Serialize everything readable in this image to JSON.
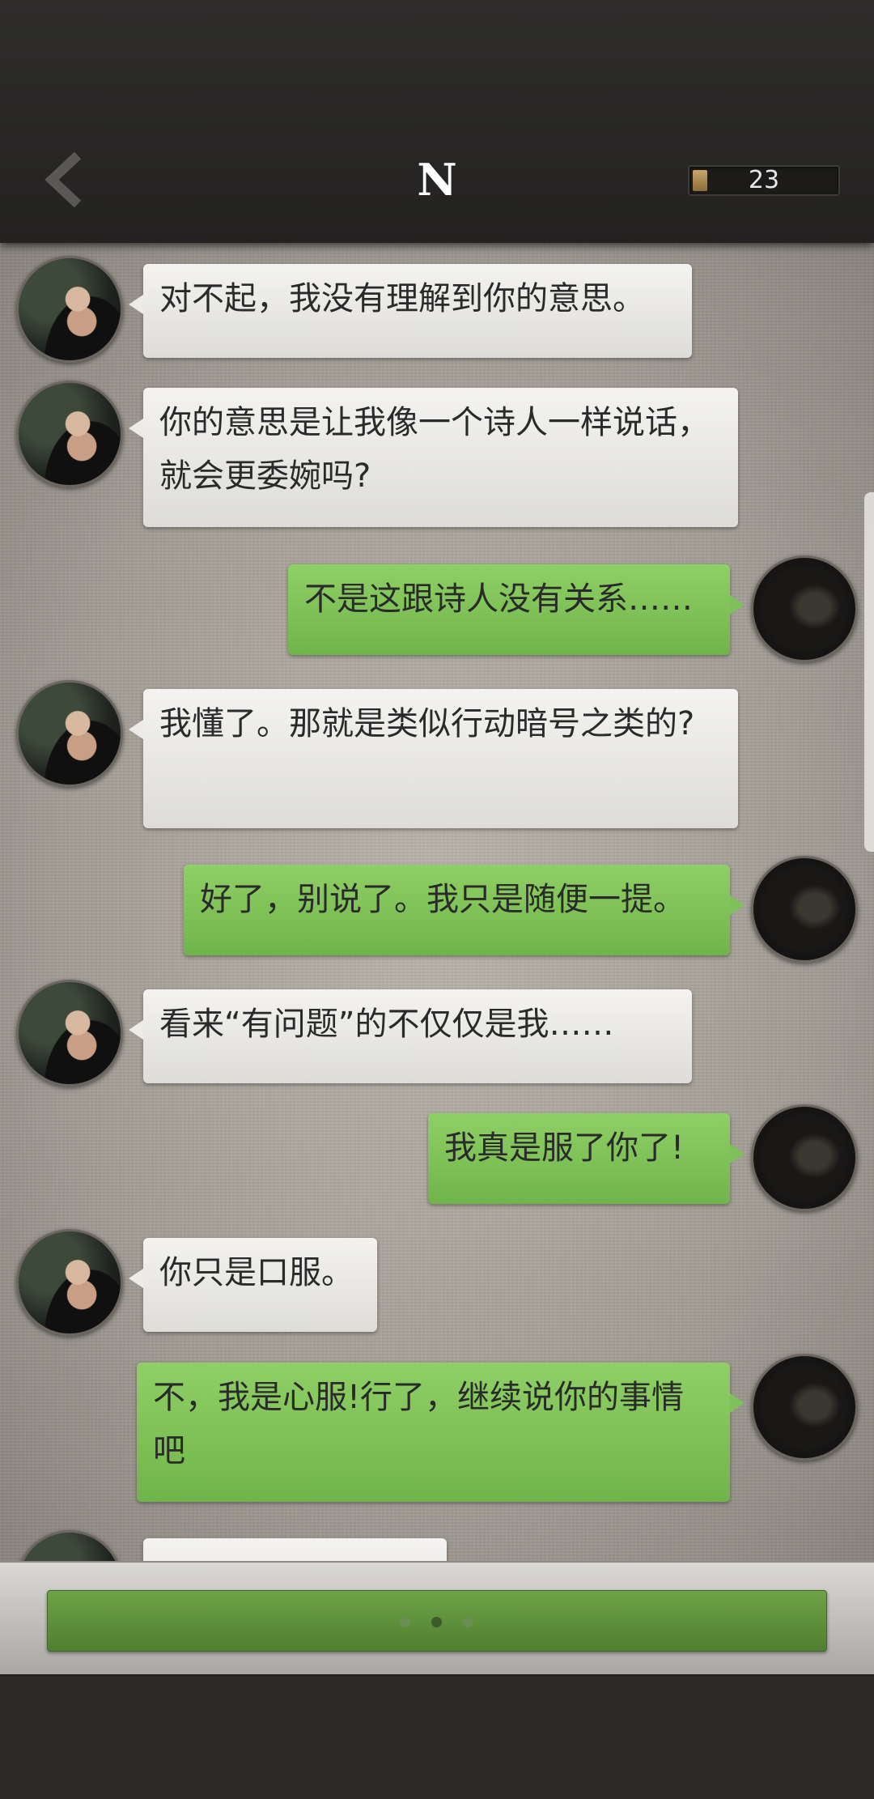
{
  "header": {
    "title": "N",
    "counter": "23",
    "back_icon": "chevron-left-icon"
  },
  "messages": [
    {
      "from": "other",
      "text": "对不起，我没有理解到你的意思。"
    },
    {
      "from": "other",
      "text": "你的意思是让我像一个诗人一样说话，就会更委婉吗?"
    },
    {
      "from": "me",
      "text": "不是这跟诗人没有关系……"
    },
    {
      "from": "other",
      "text": "我懂了。那就是类似行动暗号之类的?"
    },
    {
      "from": "me",
      "text": "好了，别说了。我只是随便一提。"
    },
    {
      "from": "other",
      "text": "看来“有问题”的不仅仅是我……"
    },
    {
      "from": "me",
      "text": "我真是服了你了!"
    },
    {
      "from": "other",
      "text": "你只是口服。"
    },
    {
      "from": "me",
      "text": "不，我是心服!行了，继续说你的事情吧"
    },
    {
      "from": "other",
      "text": ""
    }
  ],
  "input": {
    "typing_indicator": "three-dots"
  },
  "colors": {
    "me_bubble": "#7ec05a",
    "other_bubble": "#ecebe8",
    "input_button": "#5e9140"
  }
}
